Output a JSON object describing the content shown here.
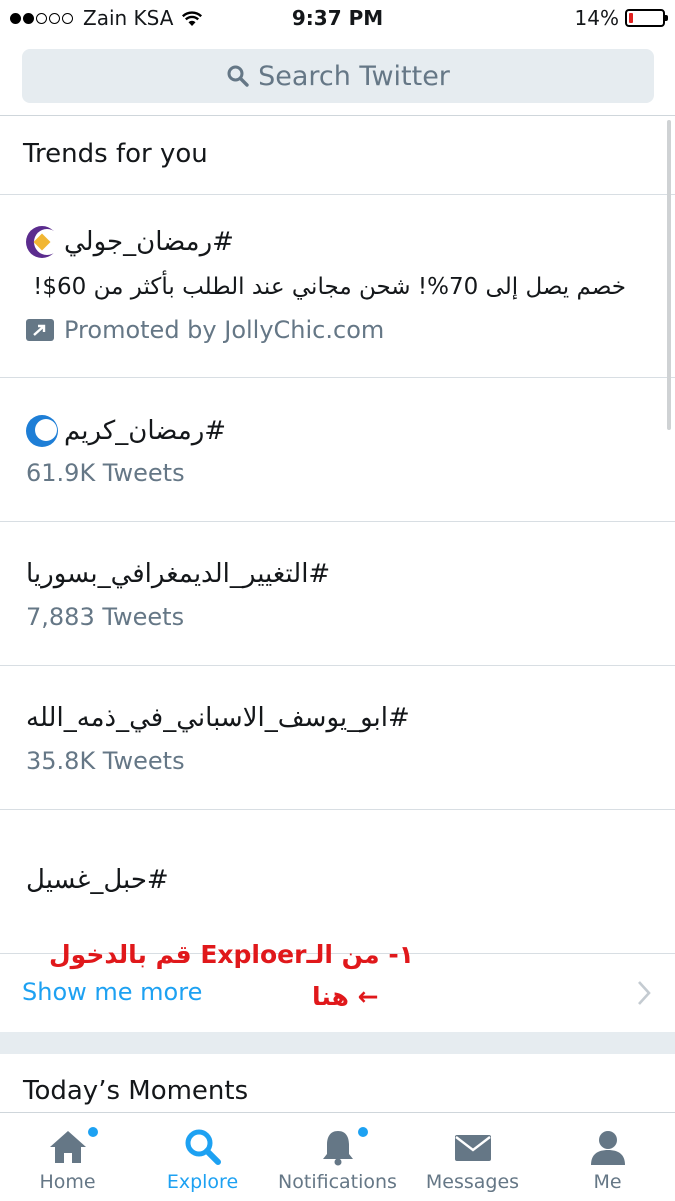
{
  "status_bar": {
    "carrier": "Zain KSA",
    "time": "9:37 PM",
    "battery": "14%",
    "battery_level": 0.14,
    "battery_color": "#e0201f"
  },
  "search": {
    "placeholder": "Search Twitter",
    "icon": "search-icon"
  },
  "trends": {
    "title": "Trends for you",
    "items": [
      {
        "name": "#رمضان_جولي",
        "description": "خصم يصل إلى 70%! شحن مجاني عند الطلب بأكثر من 60$!",
        "promoted": "Promoted by JollyChic.com",
        "icon": "ramadan-badge-icon"
      },
      {
        "name": "#رمضان_كريم",
        "count": "61.9K Tweets",
        "icon": "ramadan-crescent-icon"
      },
      {
        "name": "#التغيير_الديمغرافي_بسوريا",
        "count": "7,883 Tweets"
      },
      {
        "name": "#ابو_يوسف_الاسباني_في_ذمه_الله",
        "count": "35.8K Tweets"
      },
      {
        "name": "#حبل_غسيل"
      }
    ],
    "show_more": "Show me more"
  },
  "annotation": {
    "line1": "١- من الـExploer قم بالدخول",
    "line2": "هنا ←"
  },
  "moments": {
    "title": "Today’s Moments"
  },
  "tabbar": {
    "tabs": [
      {
        "label": "Home",
        "icon": "home-icon",
        "active": false,
        "badge": true
      },
      {
        "label": "Explore",
        "icon": "search-icon",
        "active": true,
        "badge": false
      },
      {
        "label": "Notifications",
        "icon": "bell-icon",
        "active": false,
        "badge": true
      },
      {
        "label": "Messages",
        "icon": "envelope-icon",
        "active": false,
        "badge": false
      },
      {
        "label": "Me",
        "icon": "person-icon",
        "active": false,
        "badge": false
      }
    ]
  },
  "colors": {
    "accent": "#1da1f2",
    "secondary_text": "#657786",
    "annotation": "#e0181b"
  }
}
